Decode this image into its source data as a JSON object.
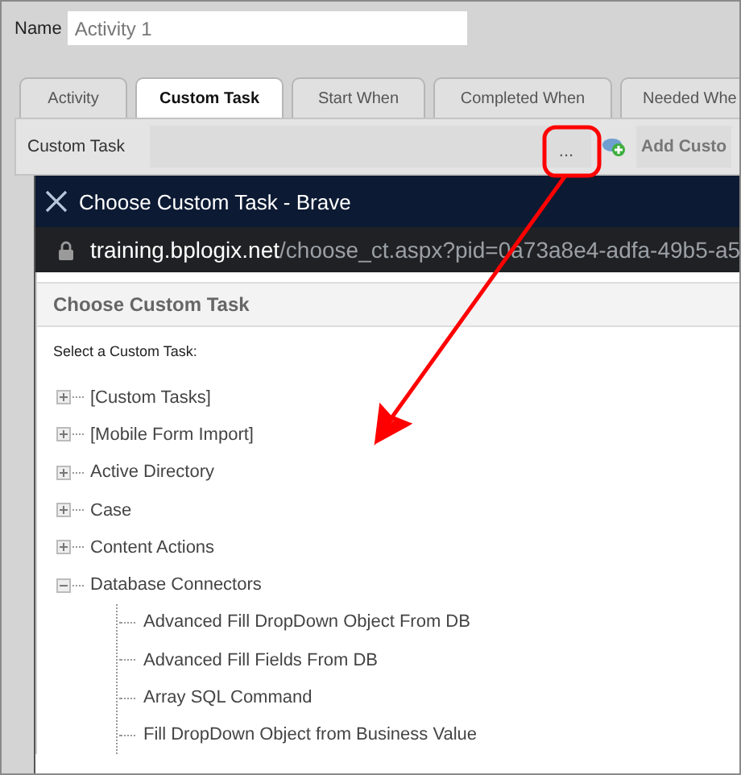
{
  "name_field": {
    "label": "Name",
    "value": "Activity 1"
  },
  "tabs": [
    {
      "label": "Activity",
      "selected": false
    },
    {
      "label": "Custom Task",
      "selected": true
    },
    {
      "label": "Start When",
      "selected": false
    },
    {
      "label": "Completed When",
      "selected": false
    },
    {
      "label": "Needed Whe",
      "selected": false
    }
  ],
  "custom_task_row": {
    "label": "Custom Task",
    "browse_button": "...",
    "add_button": "Add Custo"
  },
  "popup": {
    "title": "Choose Custom Task - Brave",
    "url_host": "training.bplogix.net",
    "url_path": "/choose_ct.aspx?pid=0a73a8e4-adfa-49b5-a5",
    "header": "Choose Custom Task",
    "prompt": "Select a Custom Task:",
    "tree": [
      {
        "label": "[Custom Tasks]",
        "expanded": false
      },
      {
        "label": "[Mobile Form Import]",
        "expanded": false
      },
      {
        "label": "Active Directory",
        "expanded": false
      },
      {
        "label": "Case",
        "expanded": false
      },
      {
        "label": "Content Actions",
        "expanded": false
      },
      {
        "label": "Database Connectors",
        "expanded": true,
        "children": [
          {
            "label": "Advanced Fill DropDown Object From DB"
          },
          {
            "label": "Advanced Fill Fields From DB"
          },
          {
            "label": "Array SQL Command"
          },
          {
            "label": "Fill DropDown Object from Business Value"
          }
        ]
      }
    ]
  }
}
